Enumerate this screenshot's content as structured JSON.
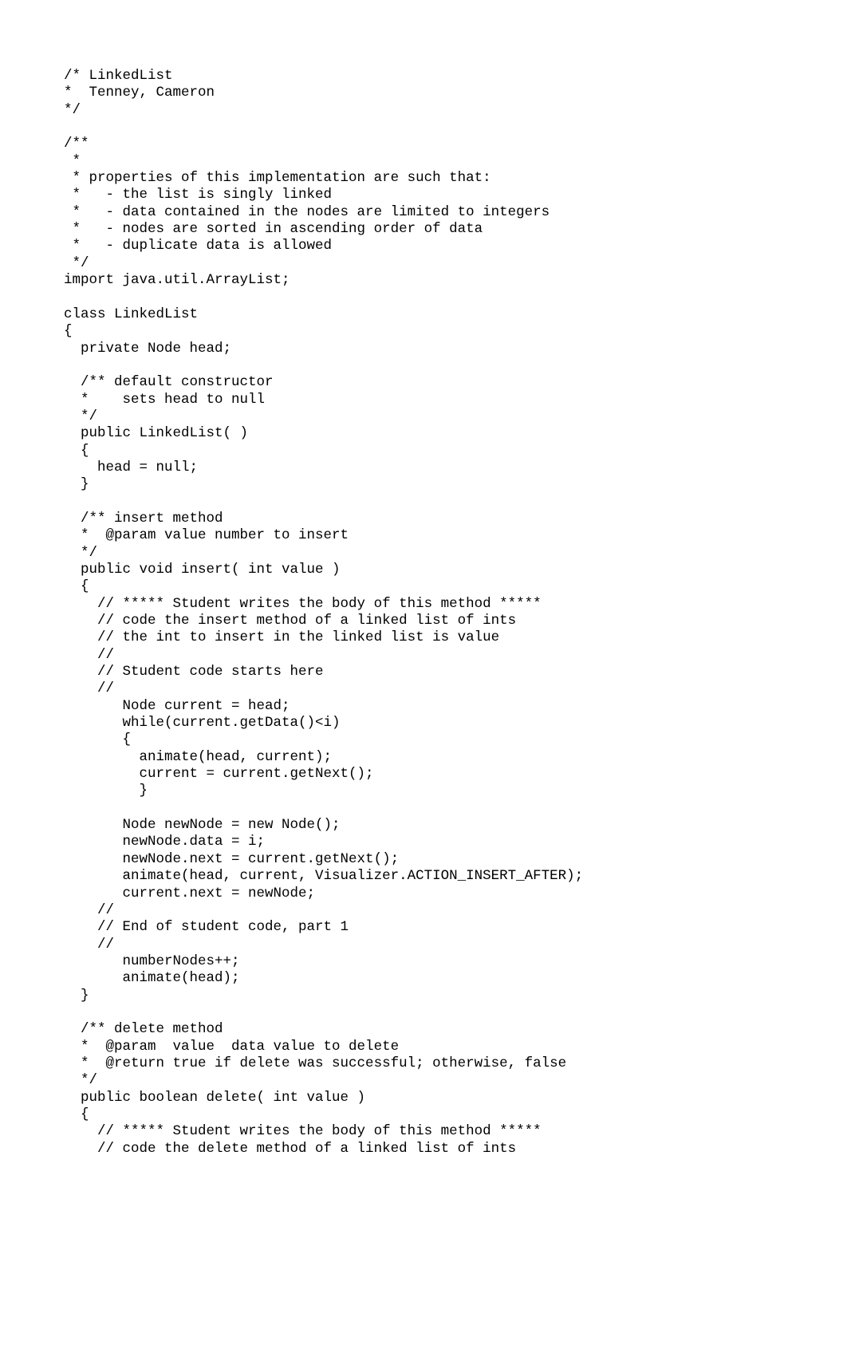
{
  "code_lines": [
    "/* LinkedList",
    "*  Tenney, Cameron",
    "*/",
    "",
    "/**",
    " *",
    " * properties of this implementation are such that:",
    " *   - the list is singly linked",
    " *   - data contained in the nodes are limited to integers",
    " *   - nodes are sorted in ascending order of data",
    " *   - duplicate data is allowed",
    " */",
    "import java.util.ArrayList;",
    "",
    "class LinkedList",
    "{",
    "  private Node head;",
    "",
    "  /** default constructor",
    "  *    sets head to null",
    "  */",
    "  public LinkedList( )",
    "  {",
    "    head = null;",
    "  }",
    "",
    "  /** insert method",
    "  *  @param value number to insert",
    "  */",
    "  public void insert( int value )",
    "  {",
    "    // ***** Student writes the body of this method *****",
    "    // code the insert method of a linked list of ints",
    "    // the int to insert in the linked list is value",
    "    //",
    "    // Student code starts here",
    "    //",
    "       Node current = head;",
    "       while(current.getData()<i)",
    "       {",
    "         animate(head, current);",
    "         current = current.getNext();",
    "         }",
    "",
    "       Node newNode = new Node();",
    "       newNode.data = i;",
    "       newNode.next = current.getNext();",
    "       animate(head, current, Visualizer.ACTION_INSERT_AFTER);",
    "       current.next = newNode;",
    "    //",
    "    // End of student code, part 1",
    "    //",
    "       numberNodes++;",
    "       animate(head);",
    "  }",
    "",
    "  /** delete method",
    "  *  @param  value  data value to delete",
    "  *  @return true if delete was successful; otherwise, false",
    "  */",
    "  public boolean delete( int value )",
    "  {",
    "    // ***** Student writes the body of this method *****",
    "    // code the delete method of a linked list of ints"
  ]
}
